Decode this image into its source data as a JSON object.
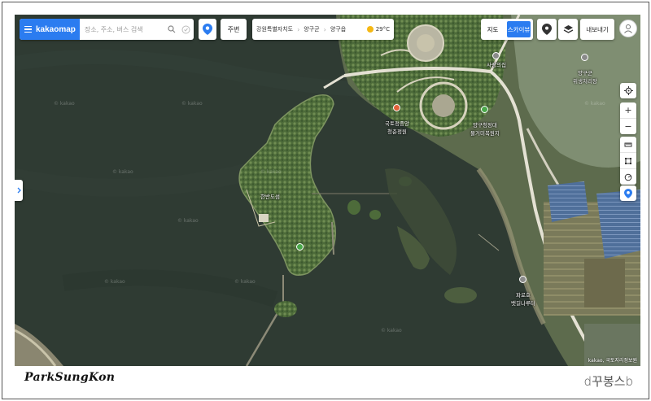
{
  "topbar": {
    "logo_text": "kakaomap",
    "search_placeholder": "장소, 주소, 버스 검색",
    "nearby_label": "주변",
    "breadcrumb": [
      "강원특별자치도",
      "양구군",
      "양구읍"
    ],
    "weather_temp": "29°C",
    "map_type_options": [
      "지도",
      "스카이뷰"
    ],
    "map_type_selected": "스카이뷰",
    "export_label": "내보내기"
  },
  "colors": {
    "brand_blue": "#2b7cf0",
    "water": "#2f3b33"
  },
  "map": {
    "view": "skyview",
    "pois": [
      {
        "label": "사랑의집",
        "icon": "clinic-icon"
      },
      {
        "label": "양구군\n위생처리장",
        "icon": "facility-icon"
      },
      {
        "label": "국토정중앙\n청춘정원",
        "icon": "park-icon"
      },
      {
        "label": "양구청정대\n물거미복원지",
        "icon": "park-icon"
      },
      {
        "label": "한반도섬",
        "icon": "place-icon"
      },
      {
        "label": "파로호\n뱃길나루터",
        "icon": "ferry-icon"
      }
    ],
    "watermark": "© kakao",
    "copyright": "kakao, 국토지리정보원"
  },
  "captions": {
    "left": "ParkSungKon",
    "right": "d꾸봉스b"
  }
}
